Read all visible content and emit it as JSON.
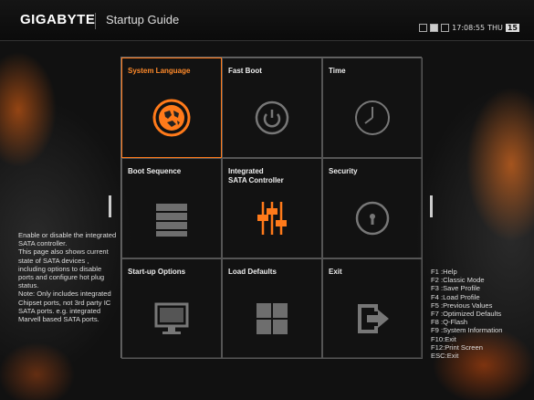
{
  "header": {
    "brand": "GIGABYTE",
    "title": "Startup Guide",
    "time": "17:08:55",
    "day": "THU",
    "date_badge": "15"
  },
  "menu": [
    {
      "label": "System Language",
      "icon": "globe-icon"
    },
    {
      "label": "Fast Boot",
      "icon": "power-icon"
    },
    {
      "label": "Time",
      "icon": "clock-icon"
    },
    {
      "label": "Boot Sequence",
      "icon": "drive-stack-icon"
    },
    {
      "label": "Integrated\nSATA Controller",
      "icon": "sliders-icon"
    },
    {
      "label": "Security",
      "icon": "lock-icon"
    },
    {
      "label": "Start-up Options",
      "icon": "monitor-icon"
    },
    {
      "label": "Load Defaults",
      "icon": "grid-icon"
    },
    {
      "label": "Exit",
      "icon": "exit-icon"
    }
  ],
  "help_text": "Enable or disable the integrated SATA controller.\nThis page also shows current state of SATA devices , including options to disable ports and configure hot plug status.\nNote: Only includes integrated Chipset ports, not 3rd party IC SATA ports. e.g. integrated Marvell based SATA ports.",
  "hotkeys": [
    "F1 :Help",
    "F2 :Classic Mode",
    "F3 :Save Profile",
    "F4 :Load Profile",
    "F5 :Previous Values",
    "F7 :Optimized Defaults",
    "F8 :Q-Flash",
    "F9 :System Information",
    "F10:Exit",
    "F12:Print Screen",
    "ESC:Exit"
  ],
  "colors": {
    "accent": "#ff7a1a",
    "icon_gray": "#7a7a7a",
    "background": "#111111"
  }
}
